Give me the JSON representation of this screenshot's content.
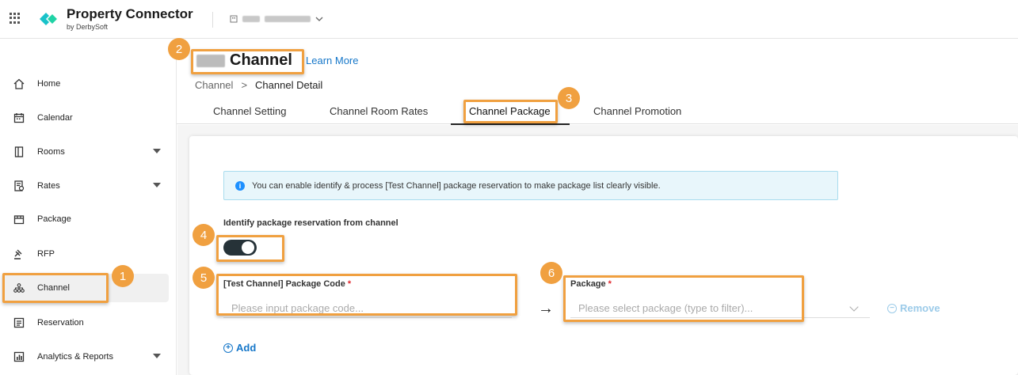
{
  "header": {
    "brand_title": "Property Connector",
    "brand_subtitle": "by DerbySoft",
    "hotel_name": ""
  },
  "sidebar": {
    "items": [
      {
        "label": "Home",
        "icon": "home-icon"
      },
      {
        "label": "Calendar",
        "icon": "calendar-icon"
      },
      {
        "label": "Rooms",
        "icon": "door-icon"
      },
      {
        "label": "Rates",
        "icon": "rates-icon"
      },
      {
        "label": "Package",
        "icon": "package-icon"
      },
      {
        "label": "RFP",
        "icon": "gavel-icon"
      },
      {
        "label": "Channel",
        "icon": "channel-icon"
      },
      {
        "label": "Reservation",
        "icon": "reservation-icon"
      },
      {
        "label": "Analytics & Reports",
        "icon": "analytics-icon"
      }
    ]
  },
  "page": {
    "title_suffix": "Channel",
    "learn_more": "Learn More",
    "breadcrumb": [
      "Channel",
      "Channel Detail"
    ]
  },
  "tabs": [
    "Channel Setting",
    "Channel Room Rates",
    "Channel Package",
    "Channel Promotion"
  ],
  "form": {
    "info_text": "You can enable identify & process [Test Channel] package reservation to make package list clearly visible.",
    "toggle_label": "Identify package reservation from channel",
    "toggle_on": true,
    "code_label": "[Test Channel] Package Code",
    "code_placeholder": "Please input package code...",
    "package_label": "Package",
    "package_placeholder": "Please select package (type to filter)...",
    "remove_label": "Remove",
    "add_label": "Add",
    "required_mark": "*",
    "arrow": "→"
  },
  "callouts": [
    "1",
    "2",
    "3",
    "4",
    "5",
    "6"
  ],
  "colors": {
    "accent": "#1677c9",
    "callout": "#f0a040",
    "toggle_on": "#263238",
    "info_bg": "#e8f6fb"
  }
}
